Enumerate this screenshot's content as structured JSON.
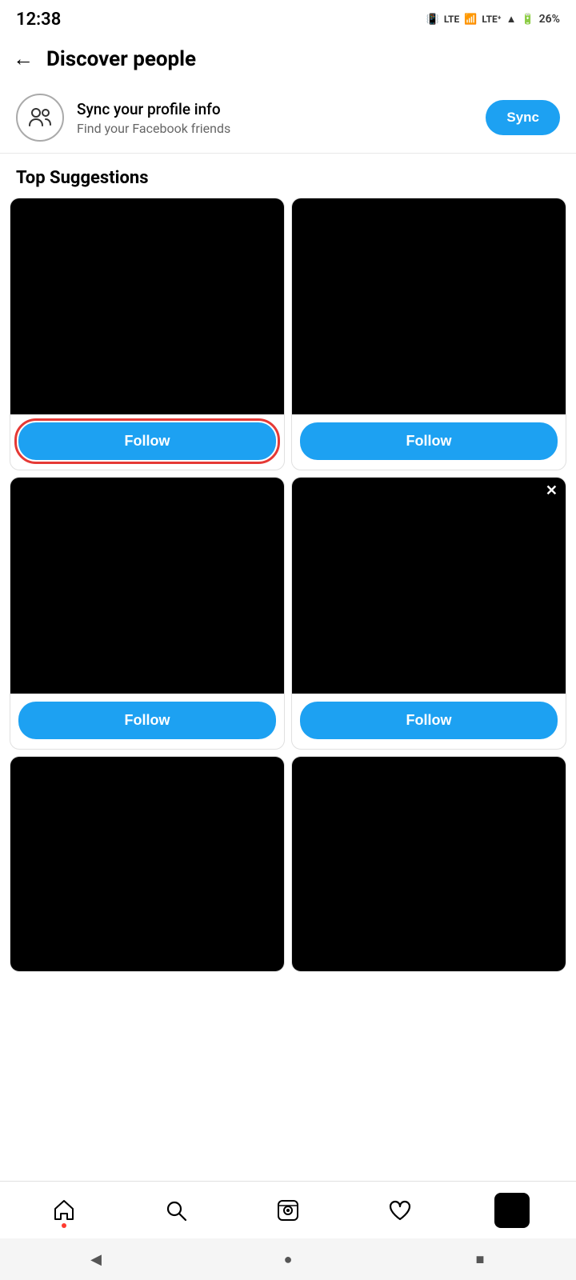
{
  "statusBar": {
    "time": "12:38",
    "battery": "26%"
  },
  "header": {
    "backLabel": "←",
    "title": "Discover people"
  },
  "syncSection": {
    "title": "Sync your profile info",
    "subtitle": "Find your Facebook friends",
    "buttonLabel": "Sync"
  },
  "topSuggestions": {
    "sectionTitle": "Top Suggestions",
    "cards": [
      {
        "id": 1,
        "followLabel": "Follow",
        "highlighted": true,
        "hasClose": false
      },
      {
        "id": 2,
        "followLabel": "Follow",
        "highlighted": false,
        "hasClose": false
      },
      {
        "id": 3,
        "followLabel": "Follow",
        "highlighted": false,
        "hasClose": false
      },
      {
        "id": 4,
        "followLabel": "Follow",
        "highlighted": false,
        "hasClose": true
      },
      {
        "id": 5,
        "followLabel": "",
        "highlighted": false,
        "hasClose": false
      },
      {
        "id": 6,
        "followLabel": "",
        "highlighted": false,
        "hasClose": false
      }
    ]
  },
  "bottomNav": {
    "items": [
      {
        "name": "home",
        "label": "Home",
        "hasDot": true
      },
      {
        "name": "search",
        "label": "Search",
        "hasDot": false
      },
      {
        "name": "reels",
        "label": "Reels",
        "hasDot": false
      },
      {
        "name": "activity",
        "label": "Activity",
        "hasDot": false
      },
      {
        "name": "profile",
        "label": "Profile",
        "hasDot": false
      }
    ]
  },
  "androidNav": {
    "back": "◀",
    "home": "●",
    "recent": "■"
  }
}
